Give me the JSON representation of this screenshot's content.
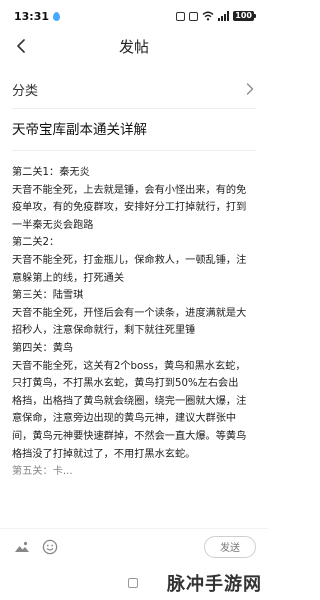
{
  "status_bar": {
    "time": "13:31",
    "battery": "100"
  },
  "header": {
    "title": "发帖"
  },
  "category": {
    "label": "分类"
  },
  "post": {
    "title": "天帝宝库副本通关详解",
    "lines": [
      "第二关1：秦无炎",
      "天音不能全死，上去就是锤，会有小怪出来，有的免",
      "疫单攻，有的免疫群攻，安排好分工打掉就行，打到",
      "一半秦无炎会跑路",
      "第二关2：",
      "天音不能全死，打金瓶儿，保命救人，一顿乱锤，注",
      "意躲第上的线，打死通关",
      "第三关：陆雪琪",
      "天音不能全死，开怪后会有一个读条，进度满就是大",
      "招秒人，注意保命就行，剩下就往死里锤",
      "第四关：黄鸟",
      "天音不能全死，这关有2个boss，黄鸟和黑水玄蛇，",
      "只打黄鸟，不打黑水玄蛇，黄鸟打到50%左右会出",
      "格挡，出格挡了黄鸟就会绕圈，绕完一圈就大爆，注",
      "意保命，注意旁边出现的黄鸟元神，建议大群张中",
      "间，黄鸟元神要快速群掉，不然会一直大爆。等黄鸟",
      "格挡没了打掉就过了，不用打黑水玄蛇。",
      "第五关：卡..."
    ]
  },
  "toolbar": {
    "send_label": "发送"
  },
  "watermark": {
    "text": "脉冲手游网"
  }
}
